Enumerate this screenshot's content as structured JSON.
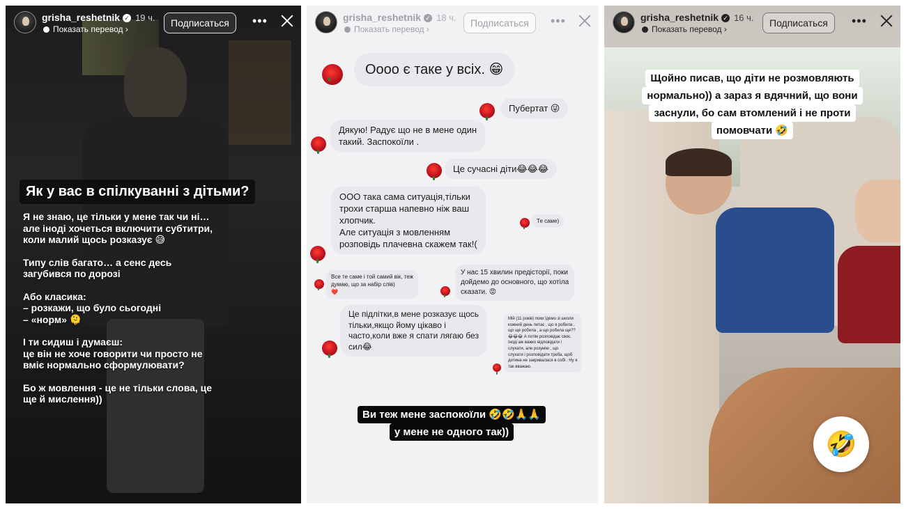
{
  "stories": [
    {
      "username": "grisha_reshetnik",
      "time": "19 ч.",
      "translate_label": "Показать перевод ›",
      "subscribe_label": "Подписаться",
      "more_label": "•••",
      "title": "Як у вас в спілкуванні з дітьми?",
      "paragraphs": [
        "Я не знаю, це тільки у мене так чи ні…\nале іноді хочеться включити субтитри,\nколи малий щось розказує 😅",
        "Типу слів багато… а сенс десь\nзагубився по дорозі",
        "Або класика:\n– розкажи, що було сьогодні\n– «норм» 🫠",
        "І ти сидиш і думаєш:\nце він не хоче говорити чи просто не\nвміє нормально сформулювати?",
        "Бо ж мовлення - це не тільки слова, це\nще й мислення))"
      ]
    },
    {
      "username": "grisha_reshetnik",
      "time": "18 ч.",
      "translate_label": "Показать перевод ›",
      "subscribe_label": "Подписаться",
      "more_label": "•••",
      "messages": [
        "Оооо є таке у всіх. 😁",
        "Пубертат 😜",
        "Дякую! Радує що не в мене один\nтакий. Заспокоїли .",
        "Це сучасні діти😂😂😂",
        "ООО така сама ситуація,тільки\nтрохи старша напевно ніж ваш\nхлопчик.\nАле ситуація з мовленням\nрозповідь плачевна скажем так!(",
        "Те саме)",
        "Все те саме і той самий вік, теж\nдумаю, що за набір слів)\n❤️",
        "У нас 15 хвилин предісторії, поки\nдойдемо до основного, що хотіла\nсказати. 😡",
        "Це підлітки,в мене розказує щось\nтільки,якщо йому цікаво і\nчасто,коли вже я спати лягаю без\nсил😂",
        "Мій (11 років) поки їдемо зі школи\nкожний день питає , що я робила ,\nщо ще робила , а що робила ще??\n😂😂😂 А потім розповідає своє.\nІноді аж важко відповідати і\nслухати, але розумію , що\nслухати і розповідати треба, щоб\nдитина не закривалася в собі . Ну я\nтак вважаю."
      ],
      "caption_lines": [
        "Ви теж мене заспокоїли 🤣🤣🙏🙏",
        "у мене не одного так))"
      ]
    },
    {
      "username": "grisha_reshetnik",
      "time": "16 ч.",
      "translate_label": "Показать перевод ›",
      "subscribe_label": "Подписаться",
      "more_label": "•••",
      "caption_lines": [
        "Щойно писав, що діти не розмовляють",
        "нормально)) а зараз я вдячний, що вони",
        "заснули, бо сам втомлений і не проти",
        "помовчати 🤣"
      ],
      "sticker": "🤣"
    }
  ]
}
